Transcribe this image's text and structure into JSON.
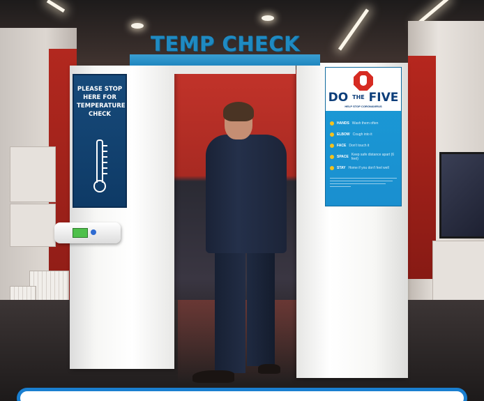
{
  "booth": {
    "sign": "TEMP CHECK",
    "accent_color": "#1f8ac2"
  },
  "left_poster": {
    "text": "PLEASE STOP\nHERE FOR\nTEMPERATURE\nCHECK",
    "icon": "thermometer-icon",
    "background_color": "#174a7a"
  },
  "right_poster": {
    "icon": "stop-hand-icon",
    "title_do": "DO",
    "title_the": "THE",
    "title_five": "FIVE",
    "subtitle": "HELP STOP CORONAVIRUS",
    "items": [
      {
        "key": "HANDS",
        "text": "Wash them often"
      },
      {
        "key": "ELBOW",
        "text": "Cough into it"
      },
      {
        "key": "FACE",
        "text": "Don't touch it"
      },
      {
        "key": "SPACE",
        "text": "Keep safe distance apart (6 feet)"
      },
      {
        "key": "STAY",
        "text": "Home if you don't feel well"
      }
    ],
    "background_color": "#1b9bd7",
    "bullet_color": "#f4c21c"
  },
  "frame": {
    "border_color": "#1a7fd0"
  }
}
